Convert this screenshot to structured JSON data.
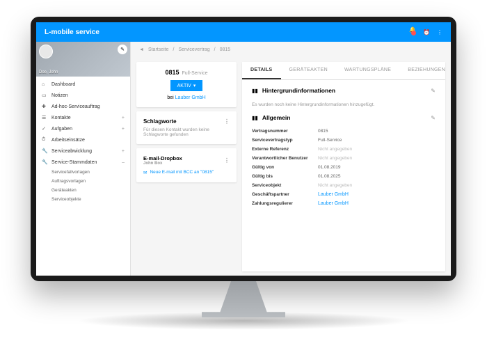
{
  "app": {
    "title": "L-mobile service"
  },
  "profile": {
    "name": "Doe, John"
  },
  "nav": {
    "items": [
      {
        "label": "Dashboard",
        "icon": "⌂"
      },
      {
        "label": "Notizen",
        "icon": "▭"
      },
      {
        "label": "Ad-hoc-Serviceauftrag",
        "icon": "✚"
      },
      {
        "label": "Kontakte",
        "icon": "☰",
        "expand": "+"
      },
      {
        "label": "Aufgaben",
        "icon": "✓",
        "expand": "+"
      },
      {
        "label": "Arbeitseinsätze",
        "icon": "⏱"
      },
      {
        "label": "Serviceabwicklung",
        "icon": "🔧",
        "expand": "+"
      },
      {
        "label": "Service-Stammdaten",
        "icon": "🔧",
        "expand": "–"
      }
    ],
    "subs": [
      "Servicefallvorlagen",
      "Auftragsvorlagen",
      "Geräteakten",
      "Serviceobjekte"
    ]
  },
  "breadcrumb": {
    "home": "Startseite",
    "section": "Servicevertrag",
    "current": "0815"
  },
  "contract": {
    "id": "0815",
    "type": "Full-Service",
    "status": "AKTIV",
    "company_prefix": "bei",
    "company": "Lauber GmbH"
  },
  "tags": {
    "title": "Schlagworte",
    "empty": "Für diesen Kontakt wurden keine Schlagworte gefunden"
  },
  "dropbox": {
    "title": "E-mail-Dropbox",
    "sub": "John Box",
    "link": "Neue E-mail mit BCC an \"0815\""
  },
  "tabs": [
    "DETAILS",
    "GERÄTEAKTEN",
    "WARTUNGSPLÄNE",
    "BEZIEHUNGEN"
  ],
  "bg": {
    "title": "Hintergrundinformationen",
    "empty": "Es wurden noch keine Hintergrundinformationen hinzugefügt."
  },
  "general": {
    "title": "Allgemein",
    "rows": [
      {
        "label": "Vertragsnummer",
        "value": "0815"
      },
      {
        "label": "Servicevertragstyp",
        "value": "Full-Service"
      },
      {
        "label": "Externe Referenz",
        "value": "Nicht angegeben",
        "na": true
      },
      {
        "label": "Verantwortlicher Benutzer",
        "value": "Nicht angegeben",
        "na": true
      },
      {
        "label": "Gültig von",
        "value": "01.08.2019"
      },
      {
        "label": "Gültig bis",
        "value": "01.08.2025"
      },
      {
        "label": "Serviceobjekt",
        "value": "Nicht angegeben",
        "na": true
      },
      {
        "label": "Geschäftspartner",
        "value": "Lauber GmbH",
        "link": true
      },
      {
        "label": "Zahlungsregulierer",
        "value": "Lauber GmbH",
        "link": true
      }
    ]
  }
}
